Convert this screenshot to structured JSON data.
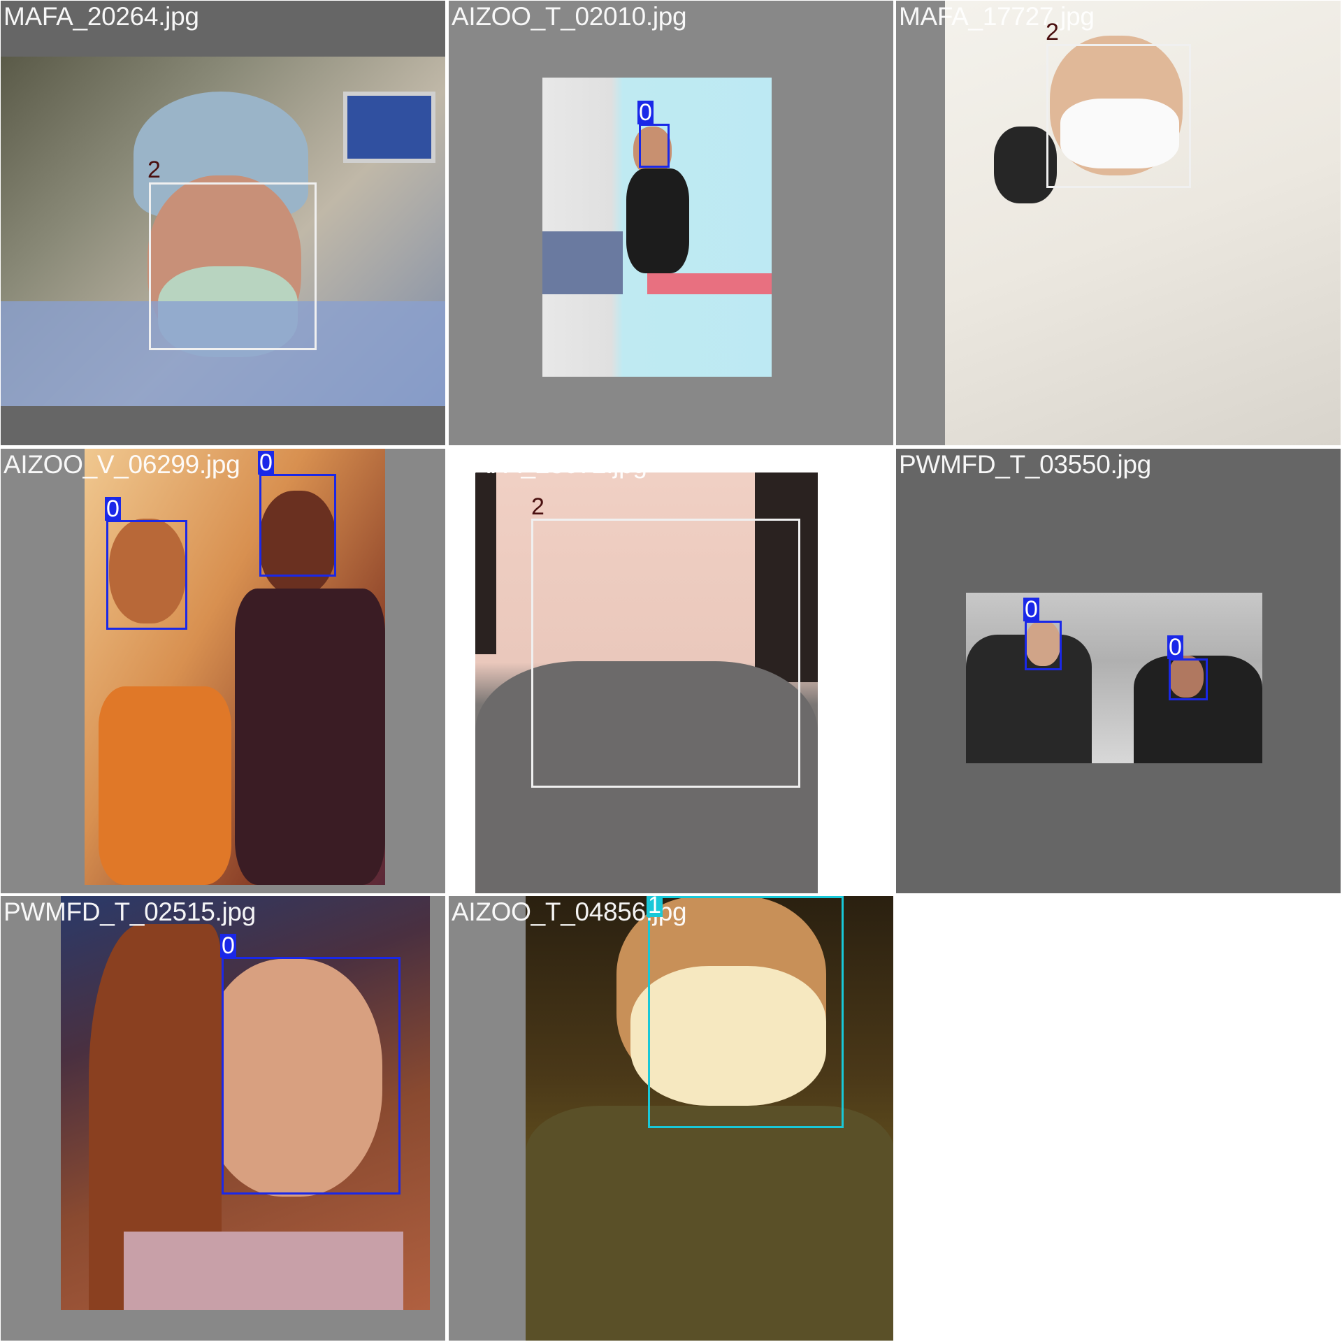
{
  "classes": {
    "0": {
      "label": "0",
      "color": "#1a28e8"
    },
    "1": {
      "label": "1",
      "color": "#18c8d8"
    },
    "2": {
      "label": "2",
      "color": "#f0f0f0"
    }
  },
  "tiles": [
    {
      "filename": "MAFA_20264.jpg",
      "box_class": "2",
      "box_label": "2"
    },
    {
      "filename": "AIZOO_T_02010.jpg",
      "box_class": "0",
      "box_label": "0"
    },
    {
      "filename": "MAFA_17727.jpg",
      "box_class": "2",
      "box_label": "2"
    },
    {
      "filename": "AIZOO_V_06299.jpg",
      "box_class": "0",
      "box_label": "0",
      "box2_label": "0"
    },
    {
      "filename": "MAFA_23672.jpg",
      "box_class": "2",
      "box_label": "2"
    },
    {
      "filename": "PWMFD_T_03550.jpg",
      "box_class": "0",
      "box_label": "0",
      "box2_label": "0"
    },
    {
      "filename": "PWMFD_T_02515.jpg",
      "box_class": "0",
      "box_label": "0"
    },
    {
      "filename": "AIZOO_T_04856.jpg",
      "box_class": "1",
      "box_label": "1"
    }
  ]
}
